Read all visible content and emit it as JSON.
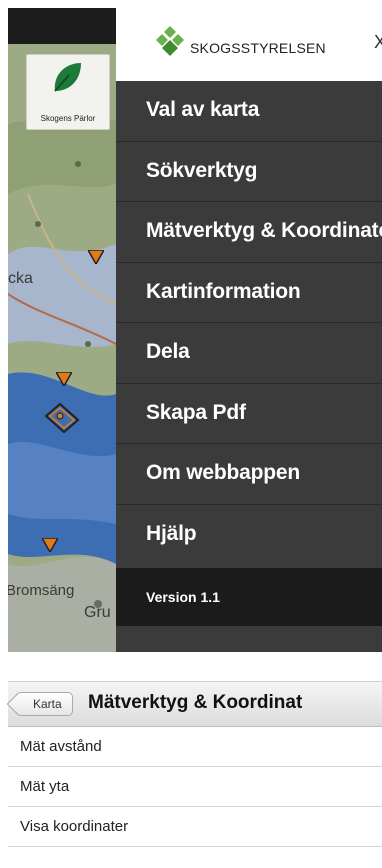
{
  "menu": {
    "brand": "SKOGSSTYRELSEN",
    "close_label": "X",
    "items": [
      {
        "label": "Val av karta"
      },
      {
        "label": "Sökverktyg"
      },
      {
        "label": "Mätverktyg & Koordinater"
      },
      {
        "label": "Kartinformation"
      },
      {
        "label": "Dela"
      },
      {
        "label": "Skapa Pdf"
      },
      {
        "label": "Om webbappen"
      },
      {
        "label": "Hjälp"
      }
    ],
    "version": "Version 1.1"
  },
  "map": {
    "logo_caption": "Skogens Pärlor",
    "labels": [
      "cka",
      "Gru",
      "Bromsäng"
    ]
  },
  "submenu": {
    "back_label": "Karta",
    "title": "Mätverktyg & Koordinat",
    "items": [
      {
        "label": "Mät avstånd"
      },
      {
        "label": "Mät yta"
      },
      {
        "label": "Visa koordinater"
      }
    ]
  },
  "colors": {
    "menu_bg": "#3b3b3b",
    "version_bg": "#1b1b1b",
    "brand_green": "#6ab04c",
    "marker_orange": "#e07a1f"
  }
}
